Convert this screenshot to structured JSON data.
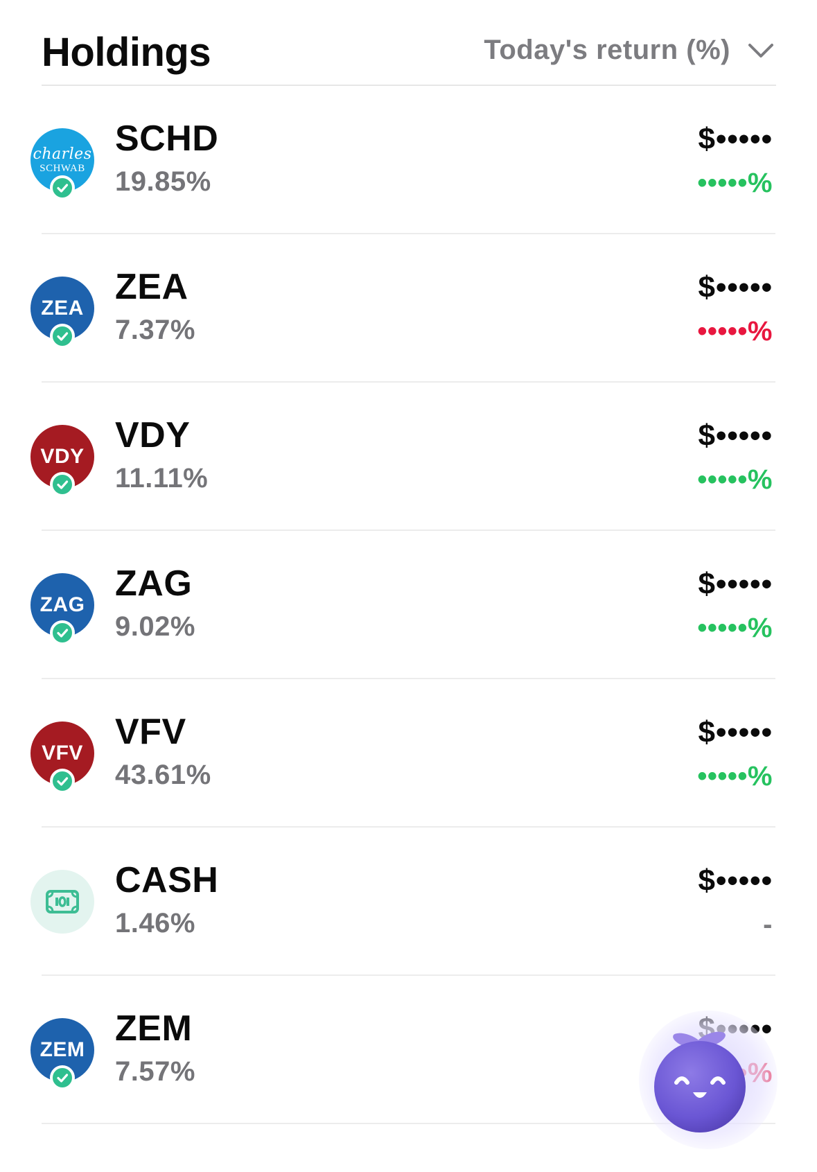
{
  "header": {
    "title": "Holdings",
    "sort_label": "Today's return (%)"
  },
  "holdings": [
    {
      "ticker": "SCHD",
      "weight": "19.85%",
      "value": "$•••••",
      "return": "•••••%",
      "trend": "up",
      "logo": {
        "style": "schwab",
        "line1": "charles",
        "line2": "SCHWAB"
      }
    },
    {
      "ticker": "ZEA",
      "weight": "7.37%",
      "value": "$•••••",
      "return": "•••••%",
      "trend": "down",
      "logo": {
        "style": "blue",
        "text": "ZEA"
      }
    },
    {
      "ticker": "VDY",
      "weight": "11.11%",
      "value": "$•••••",
      "return": "•••••%",
      "trend": "up",
      "logo": {
        "style": "red",
        "text": "VDY"
      }
    },
    {
      "ticker": "ZAG",
      "weight": "9.02%",
      "value": "$•••••",
      "return": "•••••%",
      "trend": "up",
      "logo": {
        "style": "blue",
        "text": "ZAG"
      }
    },
    {
      "ticker": "VFV",
      "weight": "43.61%",
      "value": "$•••••",
      "return": "•••••%",
      "trend": "up",
      "logo": {
        "style": "red",
        "text": "VFV"
      }
    },
    {
      "ticker": "CASH",
      "weight": "1.46%",
      "value": "$•••••",
      "return": "-",
      "trend": "flat",
      "logo": {
        "style": "cash",
        "icon": "banknote-icon"
      }
    },
    {
      "ticker": "ZEM",
      "weight": "7.57%",
      "value": "$•••••",
      "return": "•••••%",
      "trend": "down",
      "logo": {
        "style": "blue",
        "text": "ZEM"
      }
    }
  ],
  "colors": {
    "up": "#26c25f",
    "down": "#e8173f",
    "flat": "#7c7c80",
    "check": "#2fbf8f",
    "etf_blue": "#1e62ad",
    "etf_red": "#a51b22",
    "schwab": "#1aa3e0"
  },
  "icons": {
    "sort": "chevron-down-icon",
    "verified": "check-badge-icon",
    "assistant": "mascot-assistant-icon"
  }
}
